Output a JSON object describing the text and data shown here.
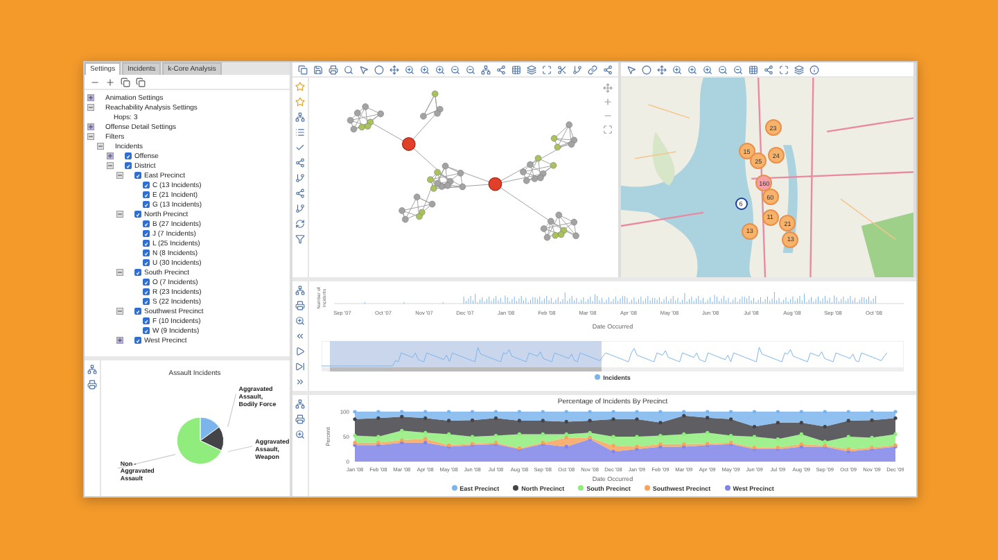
{
  "tabs": [
    {
      "label": "Settings",
      "selected": true
    },
    {
      "label": "Incidents",
      "selected": false
    },
    {
      "label": "k-Core Analysis",
      "selected": false
    }
  ],
  "tree": [
    {
      "label": "Animation Settings",
      "expanded": false
    },
    {
      "label": "Reachability Analysis Settings",
      "expanded": true,
      "children": [
        {
          "label": "Hops: 3"
        }
      ]
    },
    {
      "label": "Offense Detail Settings",
      "expanded": false
    },
    {
      "label": "Filters",
      "expanded": true,
      "children": [
        {
          "label": "Incidents",
          "expanded": true,
          "children": [
            {
              "label": "Offense",
              "checked": true,
              "expanded": false
            },
            {
              "label": "District",
              "checked": true,
              "expanded": true,
              "children": [
                {
                  "label": "East Precinct",
                  "checked": true,
                  "expanded": true,
                  "children": [
                    {
                      "label": "C (13 Incidents)",
                      "checked": true
                    },
                    {
                      "label": "E (21 Incident)",
                      "checked": true
                    },
                    {
                      "label": "G (13 Incidents)",
                      "checked": true
                    }
                  ]
                },
                {
                  "label": "North Precinct",
                  "checked": true,
                  "expanded": true,
                  "children": [
                    {
                      "label": "B (27 Incidents)",
                      "checked": true
                    },
                    {
                      "label": "J (7 Incidents)",
                      "checked": true
                    },
                    {
                      "label": "L (25 Incidents)",
                      "checked": true
                    },
                    {
                      "label": "N (8 Incidents)",
                      "checked": true
                    },
                    {
                      "label": "U (30 Incidents)",
                      "checked": true
                    }
                  ]
                },
                {
                  "label": "South Precinct",
                  "checked": true,
                  "expanded": true,
                  "children": [
                    {
                      "label": "O (7 Incidents)",
                      "checked": true
                    },
                    {
                      "label": "R (23 Incidents)",
                      "checked": true
                    },
                    {
                      "label": "S (22 Incidents)",
                      "checked": true
                    }
                  ]
                },
                {
                  "label": "Southwest Precinct",
                  "checked": true,
                  "expanded": true,
                  "children": [
                    {
                      "label": "F (10 Incidents)",
                      "checked": true
                    },
                    {
                      "label": "W (9 Incidents)",
                      "checked": true
                    }
                  ]
                },
                {
                  "label": "West Precinct",
                  "checked": true,
                  "expanded": false
                }
              ]
            }
          ]
        }
      ]
    }
  ],
  "pie": {
    "title": "Assault Incidents",
    "slices": [
      {
        "label": "Aggravated Assault, Bodily Force",
        "color": "#7cb5ec"
      },
      {
        "label": "Aggravated Assault, Weapon",
        "color": "#434348"
      },
      {
        "label": "Non - Aggravated Assault",
        "color": "#90ed7d"
      }
    ]
  },
  "map": {
    "markers": [
      {
        "count": "23",
        "color": "#f7b26b"
      },
      {
        "count": "15",
        "color": "#f7b26b"
      },
      {
        "count": "25",
        "color": "#f7b26b"
      },
      {
        "count": "24",
        "color": "#f7b26b"
      },
      {
        "count": "160",
        "color": "#f5a0a8"
      },
      {
        "count": "60",
        "color": "#f7b26b"
      },
      {
        "count": "11",
        "color": "#f7b26b"
      },
      {
        "count": "21",
        "color": "#f7b26b"
      },
      {
        "count": "13",
        "color": "#f7b26b"
      },
      {
        "count": "13",
        "color": "#f7b26b"
      },
      {
        "count": "6",
        "color": "#ffffff"
      }
    ]
  },
  "timeline": {
    "ylabel": "Number of Incidents",
    "xticks": [
      "Sep '07",
      "Oct '07",
      "Nov '07",
      "Dec '07",
      "Jan '08",
      "Feb '08",
      "Mar '08",
      "Apr '08",
      "May '08",
      "Jun '08",
      "Jul '08",
      "Aug '08",
      "Sep '08",
      "Oct '08"
    ],
    "xlabel": "Date Occurred",
    "legend": "Incidents"
  },
  "area": {
    "chart_data": {
      "type": "area",
      "title": "Percentage of Incidents By Precinct",
      "xlabel": "Date Occurred",
      "ylabel": "Percent",
      "stacked": true,
      "categories": [
        "Jan '08",
        "Feb '08",
        "Mar '08",
        "Apr '08",
        "May '08",
        "Jun '08",
        "Jul '08",
        "Aug '08",
        "Sep '08",
        "Oct '08",
        "Nov '08",
        "Dec '08",
        "Jan '09",
        "Feb '09",
        "Mar '09",
        "Apr '09",
        "May '09",
        "Jun '09",
        "Jul '09",
        "Aug '09",
        "Sep '09",
        "Oct '09",
        "Nov '09",
        "Dec '09"
      ],
      "ylim": [
        0,
        100
      ],
      "yticks": [
        0,
        50,
        100
      ],
      "series": [
        {
          "name": "East Precinct",
          "color": "#7cb5ec",
          "values": [
            15,
            13,
            10,
            13,
            18,
            17,
            13,
            18,
            18,
            20,
            18,
            15,
            15,
            22,
            8,
            12,
            15,
            30,
            22,
            22,
            30,
            18,
            17,
            13
          ]
        },
        {
          "name": "North Precinct",
          "color": "#434348",
          "values": [
            33,
            37,
            28,
            29,
            27,
            33,
            35,
            27,
            27,
            25,
            24,
            35,
            35,
            26,
            37,
            30,
            33,
            20,
            33,
            23,
            30,
            32,
            35,
            32
          ]
        },
        {
          "name": "South Precinct",
          "color": "#90ed7d",
          "values": [
            14,
            12,
            19,
            12,
            22,
            14,
            14,
            28,
            17,
            7,
            10,
            18,
            20,
            17,
            20,
            22,
            14,
            22,
            17,
            20,
            8,
            25,
            20,
            22
          ]
        },
        {
          "name": "Southwest Precinct",
          "color": "#f7a35c",
          "values": [
            5,
            5,
            5,
            8,
            3,
            3,
            3,
            2,
            3,
            18,
            3,
            12,
            5,
            5,
            5,
            3,
            3,
            3,
            3,
            5,
            2,
            5,
            3,
            3
          ]
        },
        {
          "name": "West Precinct",
          "color": "#8085e9",
          "values": [
            33,
            33,
            38,
            38,
            30,
            33,
            35,
            25,
            35,
            30,
            45,
            20,
            25,
            30,
            30,
            33,
            35,
            25,
            25,
            30,
            30,
            20,
            25,
            30
          ]
        }
      ]
    }
  }
}
